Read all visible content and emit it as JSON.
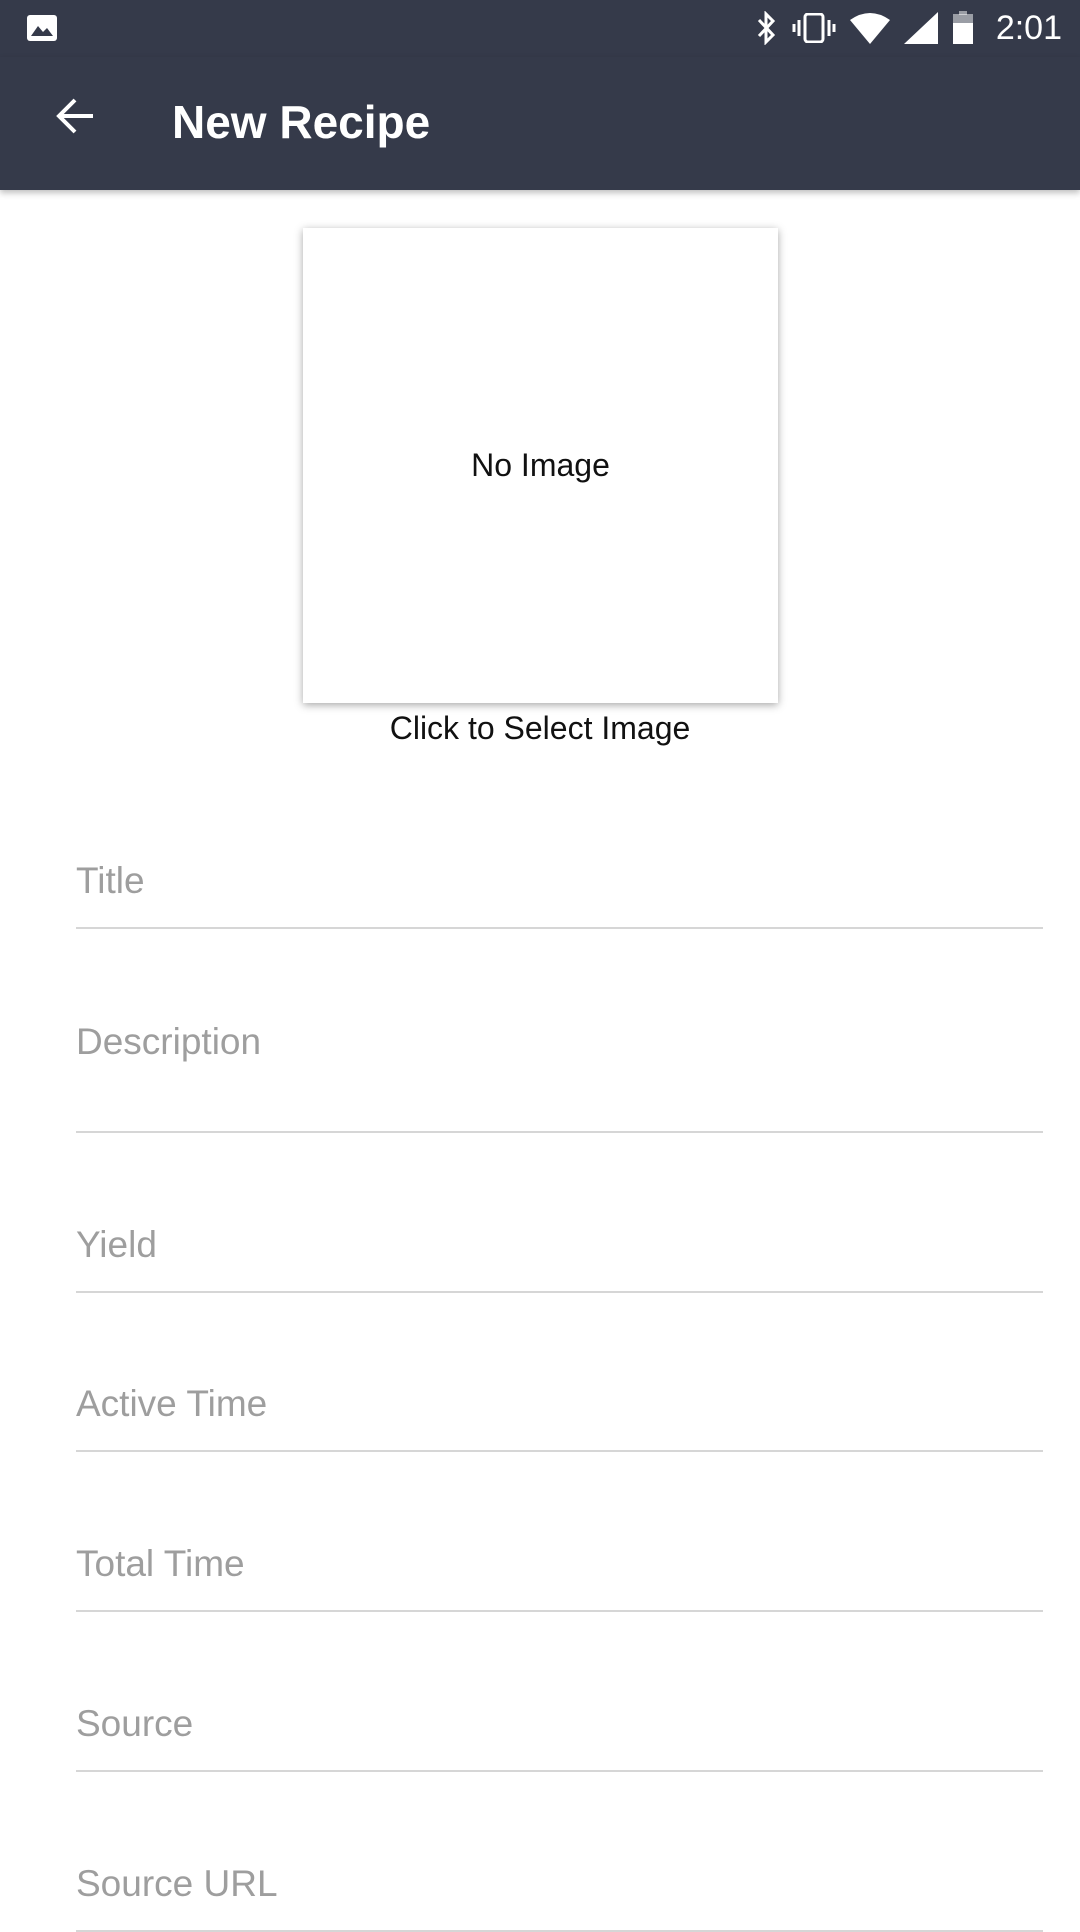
{
  "status_bar": {
    "time": "2:01",
    "icons": [
      "gallery-icon",
      "bluetooth-icon",
      "vibrate-icon",
      "wifi-icon",
      "signal-icon",
      "battery-icon"
    ]
  },
  "app_bar": {
    "title": "New Recipe",
    "back_icon": "arrow-back-icon"
  },
  "image_picker": {
    "placeholder_text": "No Image",
    "hint": "Click to Select Image"
  },
  "form": {
    "title": {
      "placeholder": "Title",
      "value": ""
    },
    "description": {
      "placeholder": "Description",
      "value": ""
    },
    "yield": {
      "placeholder": "Yield",
      "value": ""
    },
    "active_time": {
      "placeholder": "Active Time",
      "value": ""
    },
    "total_time": {
      "placeholder": "Total Time",
      "value": ""
    },
    "source": {
      "placeholder": "Source",
      "value": ""
    },
    "source_url": {
      "placeholder": "Source URL",
      "value": ""
    }
  },
  "colors": {
    "app_bar": "#353a4a",
    "placeholder": "#9e9e9e",
    "divider": "#d6d6d6"
  }
}
